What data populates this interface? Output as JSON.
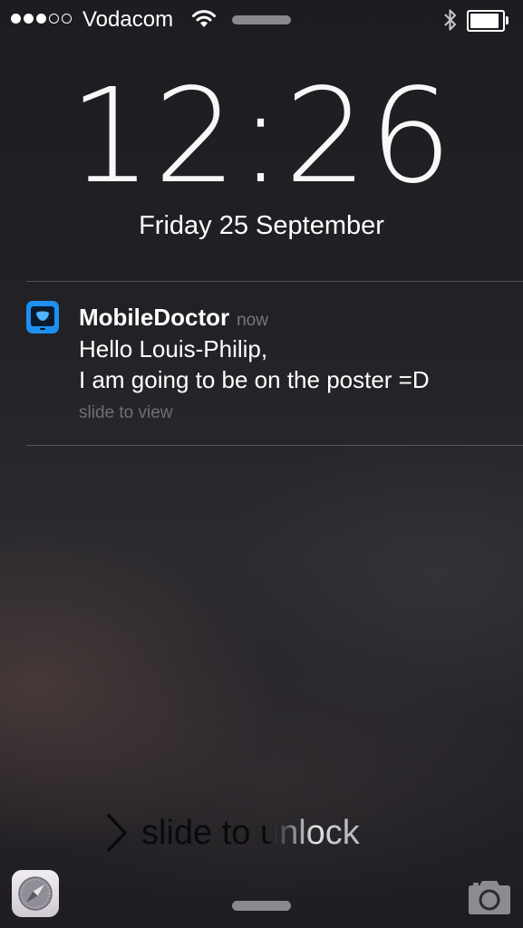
{
  "status_bar": {
    "signal_strength": 3,
    "signal_max": 5,
    "carrier": "Vodacom",
    "wifi_icon": "wifi-icon",
    "bluetooth_icon": "bluetooth-icon",
    "battery_level": 0.9
  },
  "lock_screen": {
    "time": "12:26",
    "date": "Friday 25 September"
  },
  "notification": {
    "app_icon": "mobile-doctor-app-icon",
    "app_name": "MobileDoctor",
    "time": "now",
    "message_line_1": "Hello Louis-Philip,",
    "message_line_2": "I am going to be on the poster =D",
    "hint": "slide to view",
    "icon_color": "#1e8ff0"
  },
  "bottom": {
    "unlock_text": "slide to unlock",
    "left_shortcut_icon": "safari-compass-icon",
    "right_shortcut_icon": "camera-icon"
  }
}
